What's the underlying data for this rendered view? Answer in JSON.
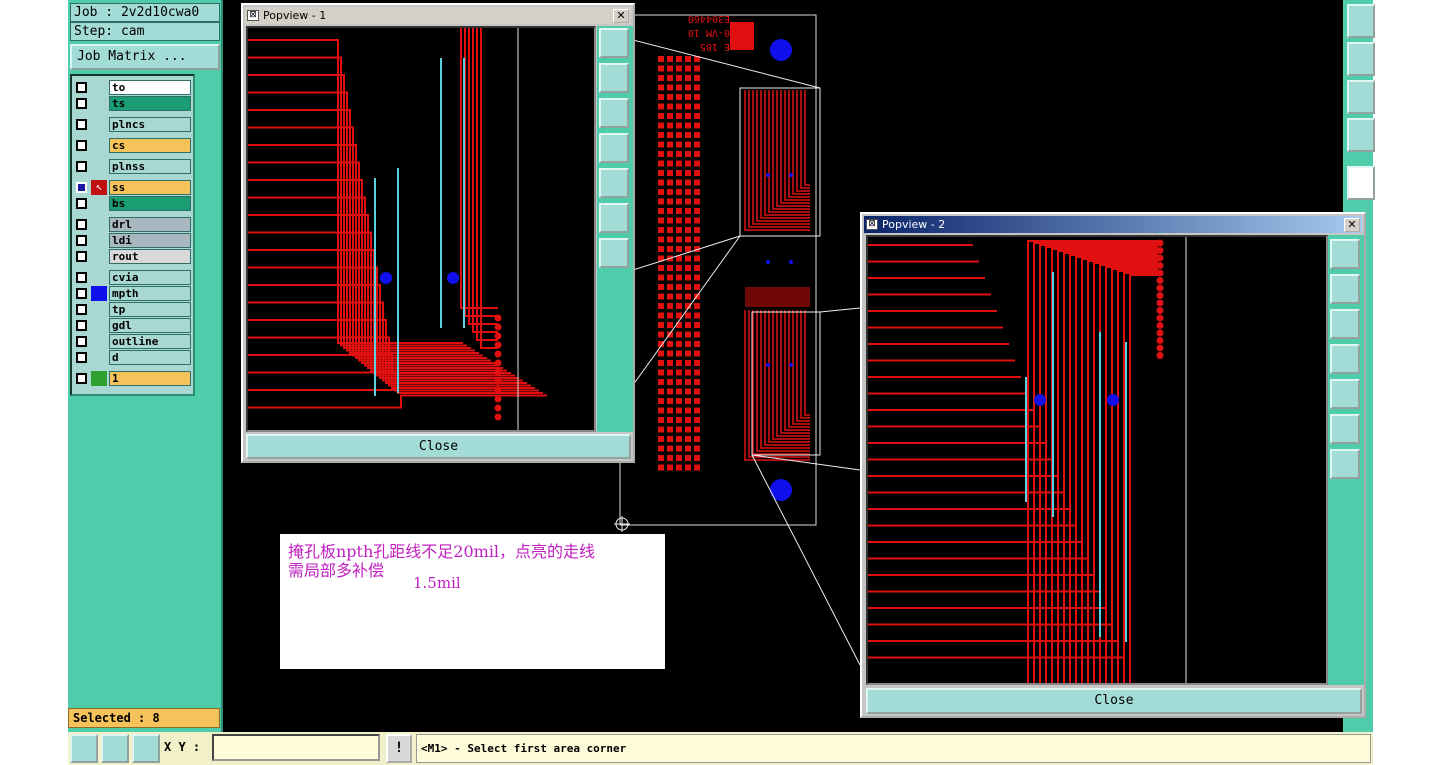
{
  "job": {
    "label": "Job : 2v2d10cwa0",
    "step": "Step: cam",
    "job_matrix_button": "Job Matrix ..."
  },
  "layers": [
    {
      "name": "to",
      "color": "#ffffff",
      "checked": false,
      "mark": ""
    },
    {
      "name": "ts",
      "color": "#1c9e74",
      "checked": false,
      "mark": ""
    },
    {
      "name": "plncs",
      "color": "#a9d8d2",
      "checked": false,
      "mark": ""
    },
    {
      "name": "cs",
      "color": "#f6c35a",
      "checked": false,
      "mark": ""
    },
    {
      "name": "plnss",
      "color": "#a9d8d2",
      "checked": false,
      "mark": ""
    },
    {
      "name": "ss",
      "color": "#f6c35a",
      "checked": true,
      "mark": "cursor"
    },
    {
      "name": "bs",
      "color": "#1c9e74",
      "checked": false,
      "mark": ""
    },
    {
      "name": "drl",
      "color": "#a9b7c0",
      "checked": false,
      "mark": ""
    },
    {
      "name": "ldi",
      "color": "#a9b7c0",
      "checked": false,
      "mark": ""
    },
    {
      "name": "rout",
      "color": "#d9d9d9",
      "checked": false,
      "mark": ""
    },
    {
      "name": "cvia",
      "color": "#a9d8d2",
      "checked": false,
      "mark": ""
    },
    {
      "name": "mpth",
      "color": "#a9d8d2",
      "checked": false,
      "mark": "blue"
    },
    {
      "name": "tp",
      "color": "#a9d8d2",
      "checked": false,
      "mark": ""
    },
    {
      "name": "gdl",
      "color": "#a9d8d2",
      "checked": false,
      "mark": ""
    },
    {
      "name": "outline",
      "color": "#a9d8d2",
      "checked": false,
      "mark": ""
    },
    {
      "name": "d",
      "color": "#a9d8d2",
      "checked": false,
      "mark": ""
    },
    {
      "name": "1",
      "color": "#f6c35a",
      "checked": false,
      "mark": "green"
    }
  ],
  "selected_label": "Selected : 8",
  "popview1": {
    "title": "Popview - 1",
    "close_label": "Close",
    "close_x": "✕"
  },
  "popview2": {
    "title": "Popview - 2",
    "close_label": "Close",
    "close_x": "✕"
  },
  "note": {
    "line1": "掩孔板npth孔距线不足20mil，点亮的走线",
    "line2": "需局部多补偿",
    "line3": "1.5mil"
  },
  "board_text": [
    "E304460",
    "0-VM 10",
    "E 185"
  ],
  "bottom": {
    "xy_label": "X Y :",
    "xy_value": "",
    "excl_label": "!",
    "status": "<M1> - Select first area corner"
  },
  "colors": {
    "panel": "#4fcdaa",
    "trace": "#e01010",
    "npth": "#1010ee",
    "highlight": "#5ad0e0"
  }
}
